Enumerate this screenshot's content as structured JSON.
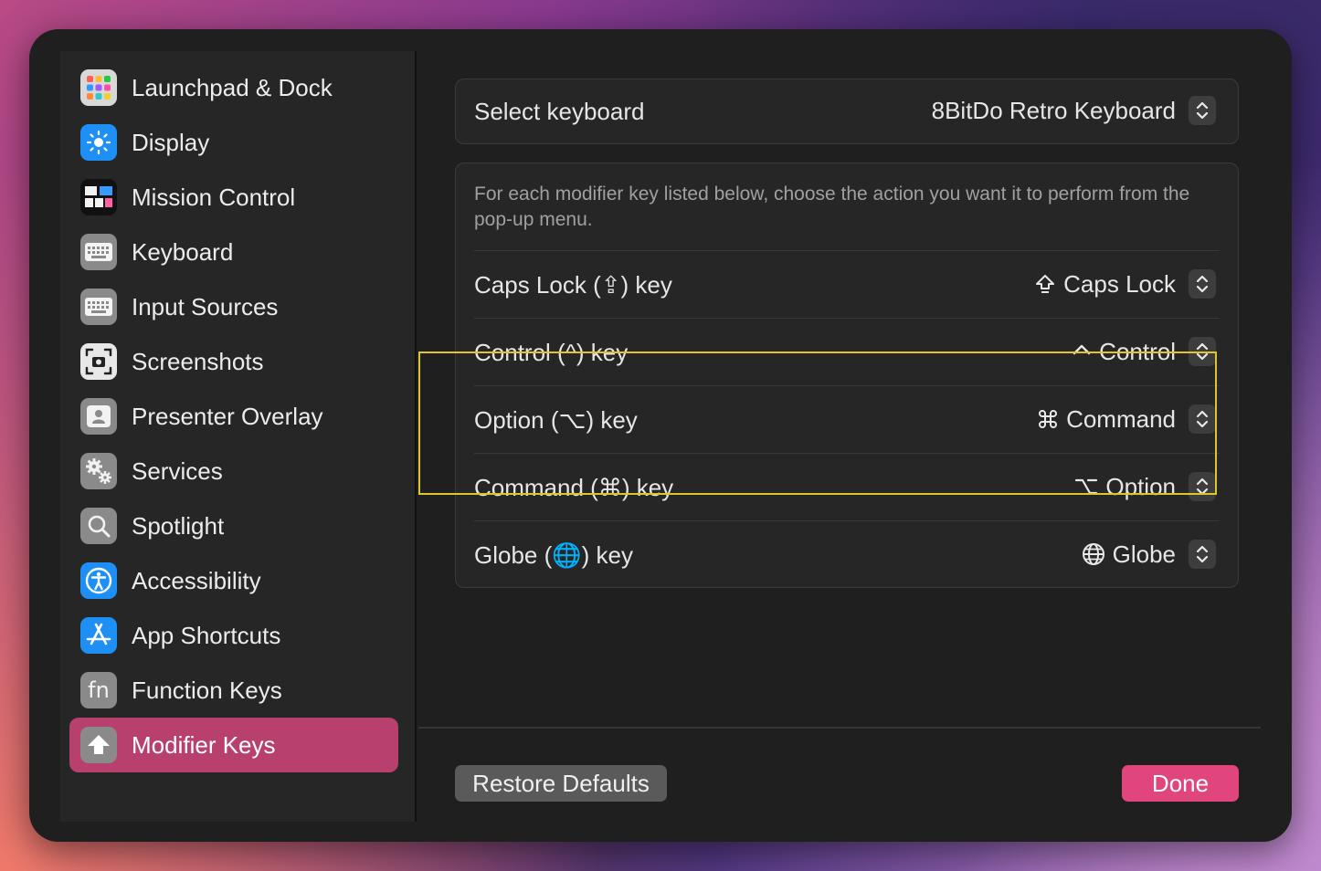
{
  "sidebar": {
    "items": [
      {
        "label": "Launchpad & Dock",
        "icon": "launchpad-icon"
      },
      {
        "label": "Display",
        "icon": "display-icon"
      },
      {
        "label": "Mission Control",
        "icon": "mission-control-icon"
      },
      {
        "label": "Keyboard",
        "icon": "keyboard-icon"
      },
      {
        "label": "Input Sources",
        "icon": "input-sources-icon"
      },
      {
        "label": "Screenshots",
        "icon": "screenshots-icon"
      },
      {
        "label": "Presenter Overlay",
        "icon": "presenter-overlay-icon"
      },
      {
        "label": "Services",
        "icon": "services-icon"
      },
      {
        "label": "Spotlight",
        "icon": "spotlight-icon"
      },
      {
        "label": "Accessibility",
        "icon": "accessibility-icon"
      },
      {
        "label": "App Shortcuts",
        "icon": "app-shortcuts-icon"
      },
      {
        "label": "Function Keys",
        "icon": "function-keys-icon"
      },
      {
        "label": "Modifier Keys",
        "icon": "modifier-keys-icon",
        "active": true
      }
    ],
    "fn_text": "fn"
  },
  "select_keyboard": {
    "label": "Select keyboard",
    "value": "8BitDo Retro Keyboard"
  },
  "modifiers": {
    "description": "For each modifier key listed below, choose the action you want it to perform from the pop-up menu.",
    "rows": [
      {
        "label": "Caps Lock (⇪) key",
        "value": "Caps Lock",
        "icon": "caps-lock-icon"
      },
      {
        "label": "Control (^) key",
        "value": "Control",
        "icon": "control-icon"
      },
      {
        "label": "Option (⌥) key",
        "value": "Command",
        "icon": "command-icon"
      },
      {
        "label": "Command (⌘) key",
        "value": "Option",
        "icon": "option-icon"
      },
      {
        "label": "Globe (🌐) key",
        "value": "Globe",
        "icon": "globe-icon"
      }
    ]
  },
  "buttons": {
    "restore": "Restore Defaults",
    "done": "Done"
  },
  "colors": {
    "accent": "#e1457d",
    "sidebar_active": "#b8406f",
    "highlight": "#e0c52a"
  }
}
